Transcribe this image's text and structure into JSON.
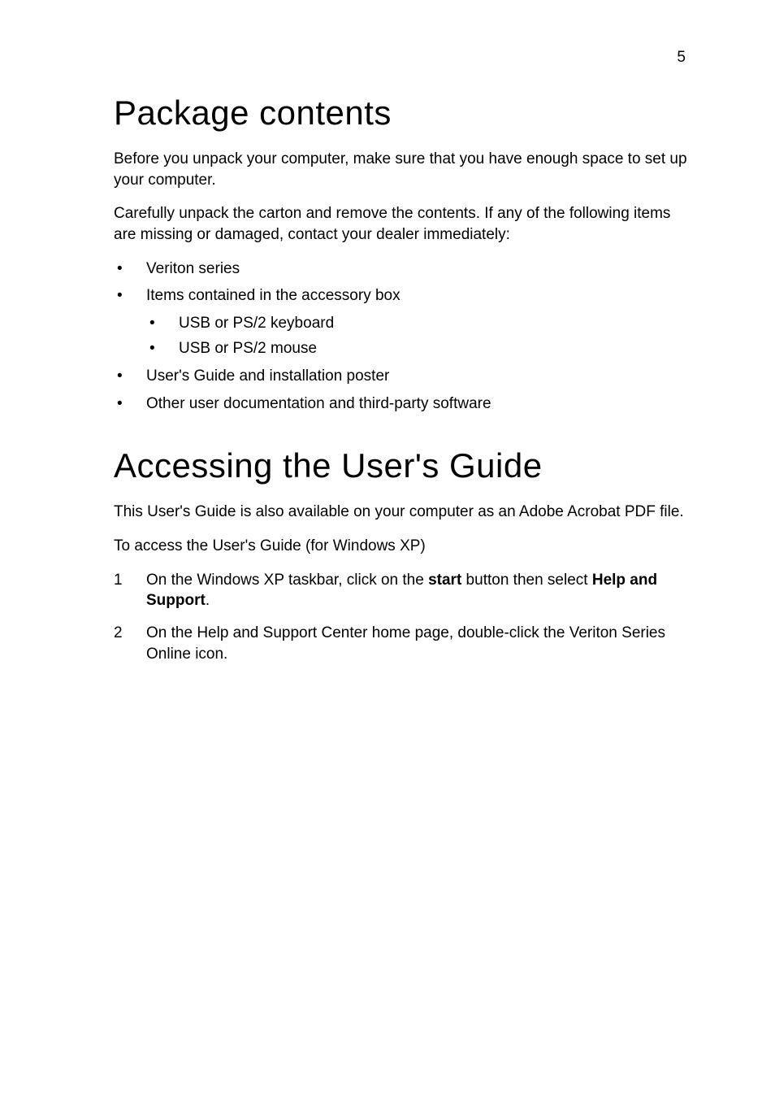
{
  "page_number": "5",
  "section1": {
    "heading": "Package contents",
    "para1": "Before you unpack your computer, make sure that you have enough space to set up your computer.",
    "para2": "Carefully unpack the carton and remove the contents. If any of the following items are missing or damaged, contact your dealer immediately:",
    "list": {
      "item1": "Veriton series",
      "item2": "Items contained in the accessory box",
      "item2_sub1": "USB or PS/2 keyboard",
      "item2_sub2": "USB or PS/2 mouse",
      "item3": "User's Guide and installation poster",
      "item4": "Other user documentation and third-party software"
    }
  },
  "section2": {
    "heading": "Accessing the User's Guide",
    "para1": "This User's Guide is also available on your computer as an Adobe Acrobat PDF file.",
    "para2": "To access the User's Guide (for Windows XP)",
    "steps": {
      "step1_num": "1",
      "step1_part1": "On the Windows XP taskbar, click on the ",
      "step1_bold1": "start",
      "step1_part2": " button then select ",
      "step1_bold2": "Help and Support",
      "step1_part3": ".",
      "step2_num": "2",
      "step2_text": "On the Help and Support Center home page, double-click the Veriton Series Online icon."
    }
  }
}
